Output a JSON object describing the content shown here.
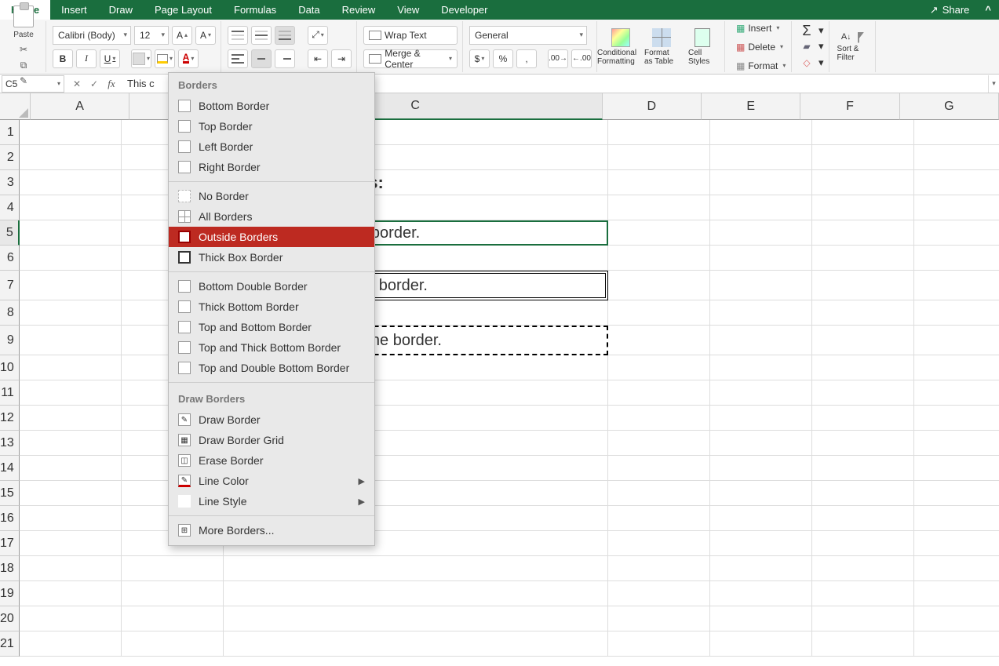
{
  "ribbon": {
    "tabs": [
      "Home",
      "Insert",
      "Draw",
      "Page Layout",
      "Formulas",
      "Data",
      "Review",
      "View",
      "Developer"
    ],
    "active": "Home",
    "share": "Share"
  },
  "toolbar": {
    "paste": "Paste",
    "font_name": "Calibri (Body)",
    "font_size": "12",
    "wrap": "Wrap Text",
    "merge": "Merge & Center",
    "number_format": "General",
    "cond_fmt": "Conditional Formatting",
    "fmt_table": "Format as Table",
    "cell_styles": "Cell Styles",
    "insert": "Insert",
    "delete": "Delete",
    "format": "Format",
    "sort_filter": "Sort & Filter"
  },
  "formula_bar": {
    "cell_ref": "C5",
    "content_preview": "This c"
  },
  "columns": [
    "A",
    "B",
    "C",
    "D",
    "E",
    "F",
    "G"
  ],
  "rows": [
    1,
    2,
    3,
    4,
    5,
    6,
    7,
    8,
    9,
    10,
    11,
    12,
    13,
    14,
    15,
    16,
    17,
    18,
    19,
    20,
    21
  ],
  "active_cell": "C5",
  "sheet": {
    "c3": "rent Border Styles:",
    "c5": "rounded by a single border.",
    "c7": "rounded by a double border.",
    "c9": "unded by a broken line border."
  },
  "borders_menu": {
    "header1": "Borders",
    "section1": [
      "Bottom Border",
      "Top Border",
      "Left Border",
      "Right Border"
    ],
    "section2": [
      "No Border",
      "All Borders",
      "Outside Borders",
      "Thick Box Border"
    ],
    "highlighted": "Outside Borders",
    "section3": [
      "Bottom Double Border",
      "Thick Bottom Border",
      "Top and Bottom Border",
      "Top and Thick Bottom Border",
      "Top and Double Bottom Border"
    ],
    "header2": "Draw Borders",
    "section4": [
      "Draw Border",
      "Draw Border Grid",
      "Erase Border",
      "Line Color",
      "Line Style"
    ],
    "more": "More Borders..."
  }
}
